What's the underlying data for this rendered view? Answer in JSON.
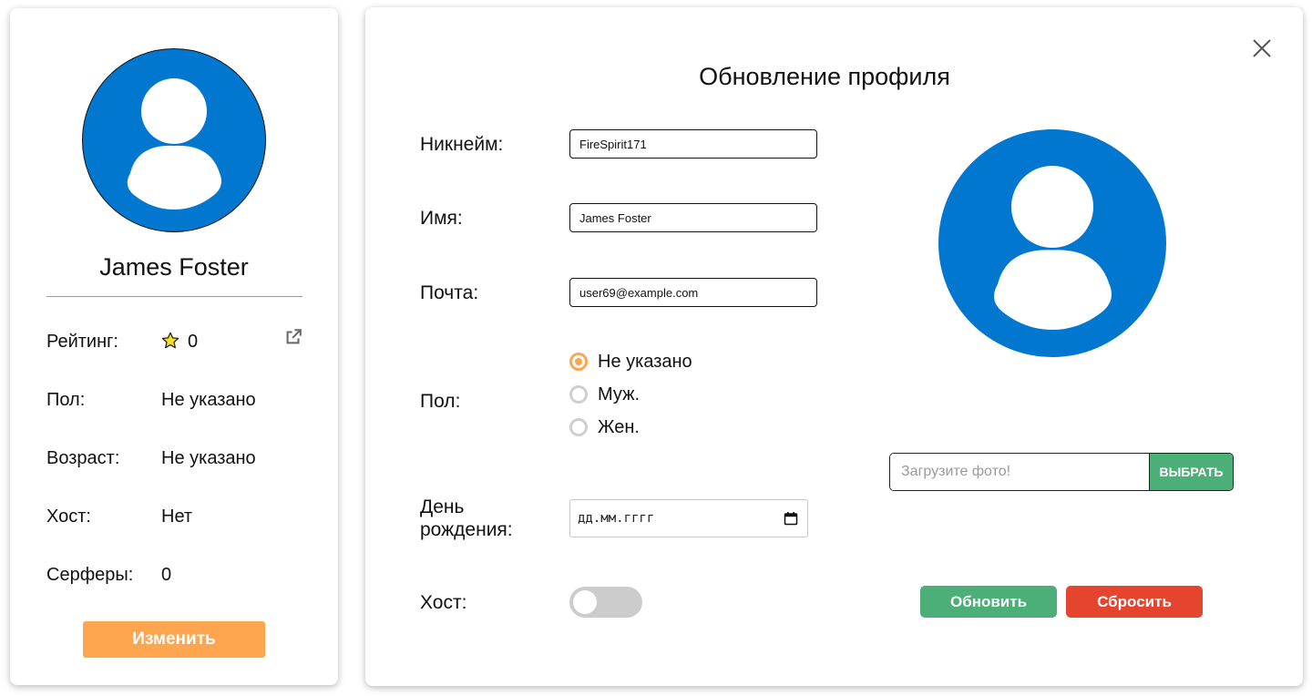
{
  "profile_card": {
    "name": "James Foster",
    "rating_label": "Рейтинг:",
    "rating_value": "0",
    "gender_label": "Пол:",
    "gender_value": "Не указано",
    "age_label": "Возраст:",
    "age_value": "Не указано",
    "host_label": "Хост:",
    "host_value": "Нет",
    "surfers_label": "Серферы:",
    "surfers_value": "0",
    "edit_button": "Изменить"
  },
  "modal": {
    "title": "Обновление профиля",
    "nickname_label": "Никнейм:",
    "nickname_value": "FireSpirit171",
    "name_label": "Имя:",
    "name_value": "James Foster",
    "email_label": "Почта:",
    "email_value": "user69@example.com",
    "gender_label": "Пол:",
    "gender_options": [
      "Не указано",
      "Муж.",
      "Жен."
    ],
    "gender_selected": "Не указано",
    "birthday_label": "День рождения:",
    "birthday_placeholder": "дд.мм.гггг",
    "host_label": "Хост:",
    "host_enabled": false,
    "upload_placeholder": "Загрузите фото!",
    "choose_button": "ВЫБРАТЬ",
    "update_button": "Обновить",
    "reset_button": "Сбросить"
  },
  "colors": {
    "avatar_blue": "#0277cf",
    "edit_orange": "#fda54f",
    "update_green": "#4caf78",
    "reset_red": "#e5452e",
    "star_yellow": "#f7e01c"
  },
  "icons": {
    "avatar": "user-silhouette-icon",
    "rating": "star-icon",
    "external_link": "external-link-icon",
    "close": "close-icon",
    "calendar": "calendar-icon"
  }
}
